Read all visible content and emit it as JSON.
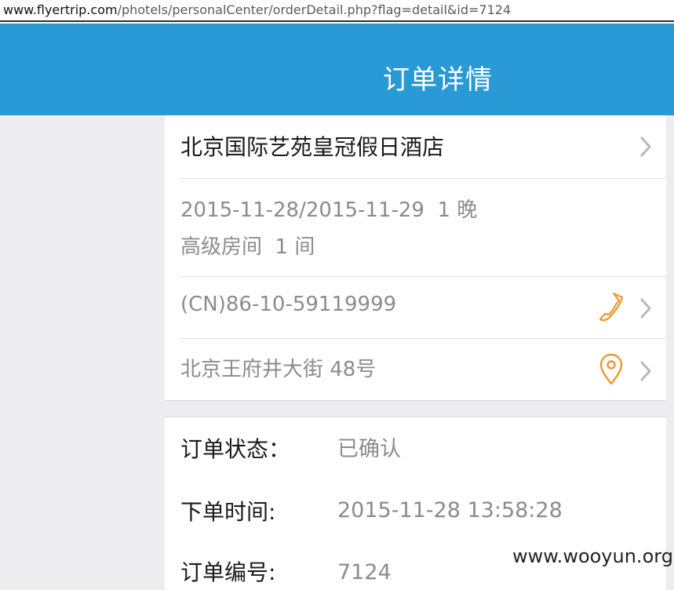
{
  "browser": {
    "url_domain": "www.flyertrip.com",
    "url_path": "/photels/personalCenter/orderDetail.php?flag=detail&id=7124"
  },
  "header": {
    "title": "订单详情"
  },
  "hotel": {
    "name": "北京国际艺苑皇冠假日酒店",
    "dates": "2015-11-28/2015-11-29",
    "nights": "1 晚",
    "room_type": "高级房间",
    "rooms": "1 间",
    "phone": "(CN)86-10-59119999",
    "address": "北京王府井大街 48号"
  },
  "order": {
    "status_label": "订单状态：",
    "status_value": "已确认",
    "time_label": "下单时间:",
    "time_value": "2015-11-28 13:58:28",
    "number_label": "订单编号:",
    "number_value": "7124"
  },
  "icons": {
    "chevron": "chevron-right-icon",
    "phone": "phone-icon",
    "location": "location-pin-icon"
  },
  "colors": {
    "header_bg": "#2a9ad6",
    "accent_orange": "#f0962e",
    "page_bg": "#ededf0"
  },
  "watermark": "www.wooyun.org"
}
